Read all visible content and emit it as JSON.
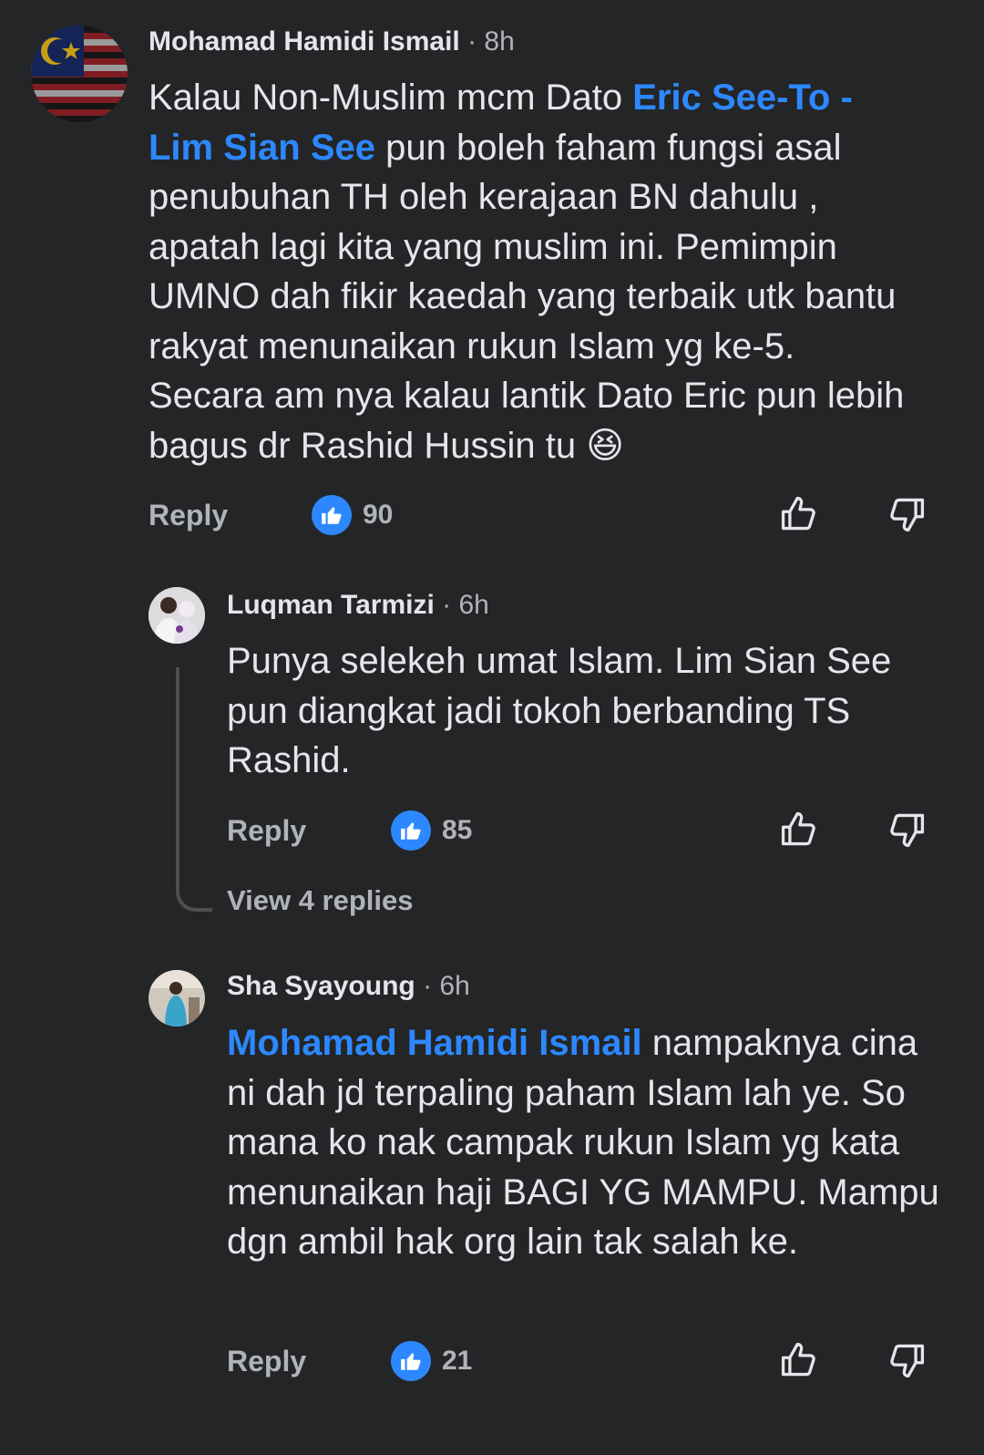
{
  "comments": [
    {
      "author": "Mohamad Hamidi Ismail",
      "time": "· 8h",
      "text_before": "Kalau Non-Muslim mcm Dato ",
      "mention": "Eric See-To - Lim Sian See",
      "text_after": " pun boleh faham fungsi asal penubuhan TH oleh kerajaan BN dahulu , apatah lagi kita yang muslim ini. Pemimpin UMNO dah fikir kaedah yang terbaik utk bantu rakyat menunaikan rukun Islam yg ke-5. Secara am nya kalau lantik Dato Eric pun lebih bagus dr Rashid Hussin tu",
      "emoji": "😆",
      "reply_label": "Reply",
      "likes": "90"
    },
    {
      "author": "Luqman Tarmizi",
      "time": "· 6h",
      "text": "Punya selekeh umat Islam. Lim Sian See pun diangkat jadi tokoh berbanding TS Rashid.",
      "reply_label": "Reply",
      "likes": "85",
      "view_replies": "View 4 replies"
    },
    {
      "author": "Sha Syayoung",
      "time": "· 6h",
      "mention": "Mohamad Hamidi Ismail",
      "text_after": " nampaknya cina ni dah jd terpaling paham Islam lah ye. So mana ko nak campak rukun Islam yg kata menunaikan haji BAGI YG MAMPU. Mampu dgn ambil hak org lain tak salah ke.",
      "reply_label": "Reply",
      "likes": "21"
    }
  ],
  "icons": {
    "like_reaction": "like-reaction-icon",
    "thumbs_up": "thumbs-up-icon",
    "thumbs_down": "thumbs-down-icon"
  },
  "colors": {
    "background": "#242526",
    "text": "#e4e6eb",
    "secondary_text": "#b0b3b8",
    "mention": "#2d88ff",
    "like_blue": "#2d88ff"
  }
}
